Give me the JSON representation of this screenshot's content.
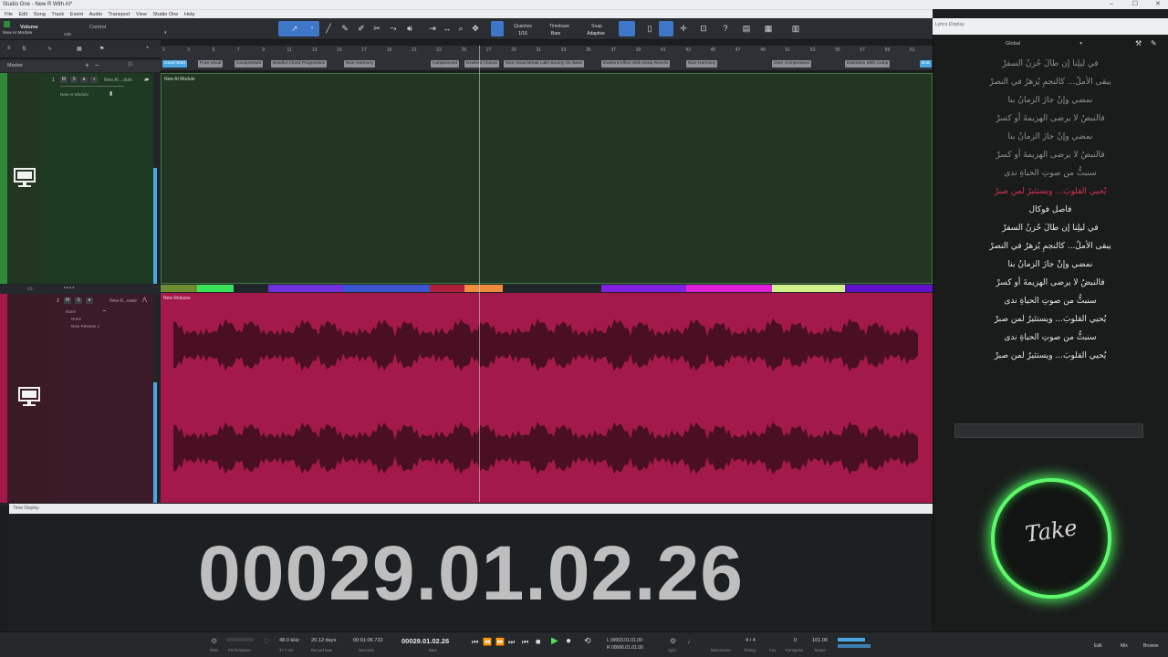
{
  "window": {
    "title": "Studio One - New R With AI*"
  },
  "menu": [
    "File",
    "Edit",
    "Song",
    "Track",
    "Event",
    "Audio",
    "Transport",
    "View",
    "Studio One",
    "Help"
  ],
  "toolbar": {
    "volume_label": "Volume",
    "track_name": "New AI Module",
    "db": "0dB",
    "control_label": "Control",
    "quantize_label": "Quantize",
    "quantize_value": "1/16",
    "timebase_label": "Timebase",
    "timebase_value": "Bars",
    "snap_label": "Snap",
    "snap_value": "Adaptive"
  },
  "marker_header": "Marker",
  "ruler": {
    "bars": [
      "1",
      "3",
      "5",
      "7",
      "9",
      "11",
      "13",
      "15",
      "17",
      "19",
      "21",
      "23",
      "25",
      "27",
      "29",
      "31",
      "33",
      "35",
      "37",
      "39",
      "41",
      "43",
      "45",
      "47",
      "49",
      "51",
      "53",
      "55",
      "57",
      "59",
      "61"
    ],
    "markers": [
      "Good Start",
      "Pure Vocal",
      "Compressed",
      "Beatiful Chord Progression",
      "Nice Harmony",
      "Compressed",
      "Exellent Chorus",
      "Nice Vocal Break Little Boomy On Bass",
      "Exellent Effect With Deep Reverb",
      "Nice Harmony",
      "Over Compressed",
      "Distortion With Comp",
      "End"
    ]
  },
  "tracks": [
    {
      "number": "1",
      "name": "New AI ...dule",
      "insert": "New AI Module",
      "mute": "M",
      "solo": "S",
      "event": "New AI Module",
      "color": "#2f8a3a"
    },
    {
      "number": "2",
      "name": "New R...ease",
      "input": "None",
      "output": "New Release 1",
      "mute": "M",
      "solo": "S",
      "event": "New Release",
      "color": "#a31a4a"
    }
  ],
  "time_display": {
    "header": "Time Display",
    "value": "00029.01.02.26"
  },
  "transport": {
    "midi": "MIDI",
    "performance": "Performance",
    "sample_rate": "48.0 kHz",
    "latency": "37.7 ms",
    "record_max_value": "20.12 days",
    "record_max": "Record Max",
    "seconds_value": "00:01:06.722",
    "seconds": "Seconds",
    "bars_value": "00029.01.02.26",
    "bars": "Bars",
    "loop_start": "L 00003.01.01.00",
    "loop_end": "R 00066.01.01.00",
    "sync": "Sync",
    "metronome": "Metronome",
    "signature": "4 / 4",
    "timing": "Timing",
    "key": "Key",
    "transpose_value": "0",
    "transpose": "Transpose",
    "tempo_value": "101.00",
    "tempo": "Tempo",
    "edit": "Edit",
    "mix": "Mix",
    "browse": "Browse"
  },
  "lyrics_panel": {
    "header": "Lyrics Display",
    "scope": "Global",
    "lines": [
      {
        "text": "في ليلِنا إن طالَ حُزنُ السفرْ",
        "color": "#8e9090"
      },
      {
        "text": "يبقى الأملُ... كالنجمِ يُزهرُ في النصرْ",
        "color": "#8e9090"
      },
      {
        "text": "نمضي وإنْ جازَ الزمانُ بنا",
        "color": "#8e9090"
      },
      {
        "text": "فالنبضُ لا يرضى الهزيمةَ أو كسرْ",
        "color": "#8e9090"
      },
      {
        "text": "نمضي وإنْ جازَ الزمانُ بنا",
        "color": "#8e9090"
      },
      {
        "text": "فالنبضُ لا يرضى الهزيمةَ أو كسرْ",
        "color": "#8e9090"
      },
      {
        "text": "سنبثُّ من صوتِ الحياةِ ندى",
        "color": "#8e9090"
      },
      {
        "text": "يُحيي القلوبَ... ويستثيرُ لمن صبرْ",
        "color": "#d6324d"
      },
      {
        "text": "فاصل فوكال",
        "color": "#e8e8e8"
      },
      {
        "text": "في ليلِنا إن طالَ حُزنُ السفرْ",
        "color": "#e8e8e8"
      },
      {
        "text": "يبقى الأملُ... كالنجمِ يُزهرُ في النصرْ",
        "color": "#e8e8e8"
      },
      {
        "text": "نمضي وإنْ جازَ الزمانُ بنا",
        "color": "#e8e8e8"
      },
      {
        "text": "فالنبضُ لا يرضى الهزيمةَ أو كسرْ",
        "color": "#e8e8e8"
      },
      {
        "text": "سنبثُّ من صوتِ الحياةِ ندى",
        "color": "#e8e8e8"
      },
      {
        "text": "يُحيي القلوبَ... ويستثيرُ لمن صبرْ",
        "color": "#e8e8e8"
      },
      {
        "text": "سنبثُّ من صوتِ الحياةِ ندى",
        "color": "#e8e8e8"
      },
      {
        "text": "يُحيي القلوبَ... ويستثيرُ لمن صبرْ",
        "color": "#e8e8e8"
      }
    ]
  },
  "logo_text": "Take",
  "colors": {
    "accent": "#3e76c8",
    "track1": "#233623",
    "track2": "#a31a4a",
    "logo_glow": "#5ff86d",
    "active_lyric": "#d6324d"
  }
}
